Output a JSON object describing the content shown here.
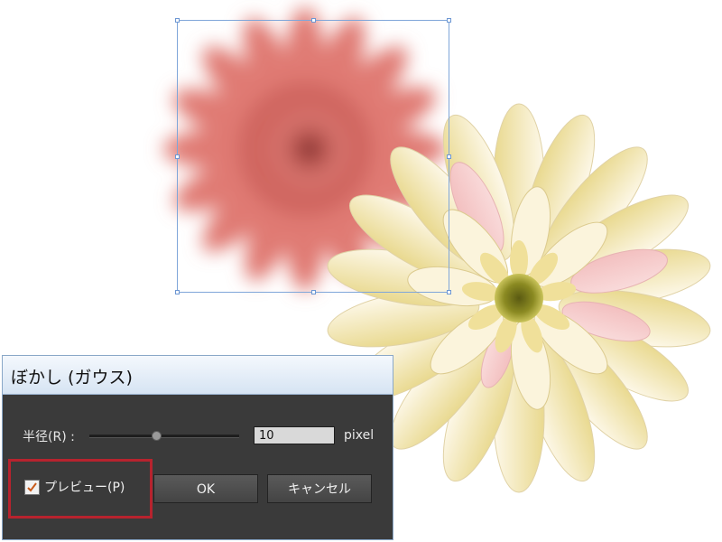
{
  "dialog": {
    "title": "ぼかし (ガウス)",
    "radius_label": "半径(R) :",
    "radius_value": "10",
    "unit": "pixel",
    "radius_slider_fraction": 0.45,
    "preview_label": "プレビュー(P)",
    "preview_checked": true,
    "ok_label": "OK",
    "cancel_label": "キャンセル"
  },
  "colors": {
    "dialog_bg": "#3a3a3a",
    "highlight_frame": "#b7232e",
    "selection": "#7fa6d9",
    "blurred_flower": "#d9706a",
    "sharp_flower_petal": "#f6eccf",
    "sharp_flower_center": "#7d7a1e"
  }
}
